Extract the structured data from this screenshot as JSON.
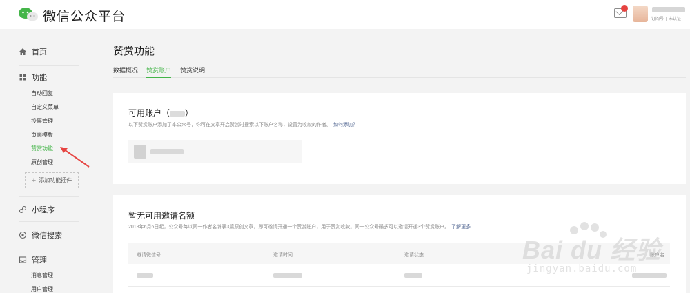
{
  "header": {
    "brand": "微信公众平台",
    "account_type": "订阅号",
    "account_status": "未认证"
  },
  "sidebar": {
    "home": "首页",
    "function": "功能",
    "function_items": [
      "自动回复",
      "自定义菜单",
      "投票管理",
      "页面模版",
      "赞赏功能",
      "原创管理"
    ],
    "active_item": "赞赏功能",
    "add_plugin": "添加功能插件",
    "mini_program": "小程序",
    "wechat_search": "微信搜索",
    "manage": "管理",
    "manage_items": [
      "消息管理",
      "用户管理"
    ]
  },
  "main": {
    "title": "赞赏功能",
    "tabs": [
      "数据概况",
      "赞赏账户",
      "赞赏说明"
    ],
    "active_tab": "赞赏账户",
    "available": {
      "title_prefix": "可用账户（",
      "title_suffix": "）",
      "desc": "以下赞赏账户添加了本公众号，你可在文章开启赞赏时搜索以下账户名称，设置为收款的作者。",
      "link": "如何添加？"
    },
    "invite": {
      "title": "暂无可用邀请名额",
      "desc": "2018年6月6日起，公众号每以同一作者名发表3篇原创文章，即可邀请开通一个赞赏账户，用于赞赏收款。同一公众号最多可以邀请开通3个赞赏账户。",
      "link": "了解更多",
      "columns": [
        "邀请微信号",
        "邀请时间",
        "邀请状态",
        "账户名"
      ]
    }
  },
  "watermark": {
    "text": "Bai du 经验",
    "sub": "jingyan.baidu.com"
  },
  "colors": {
    "accent": "#44b549",
    "link": "#576b95",
    "arrow": "#e64340"
  }
}
